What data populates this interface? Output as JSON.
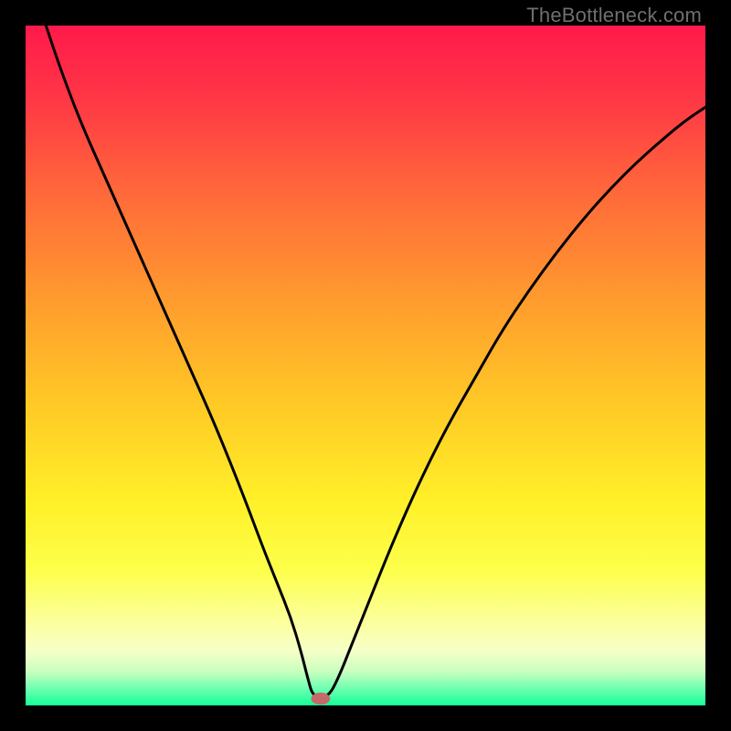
{
  "watermark": "TheBottleneck.com",
  "chart_data": {
    "type": "line",
    "title": "",
    "xlabel": "",
    "ylabel": "",
    "xlim": [
      0,
      100
    ],
    "ylim": [
      0,
      100
    ],
    "background_gradient": {
      "stops": [
        {
          "offset": 0.0,
          "color": "#ff1a4b"
        },
        {
          "offset": 0.1,
          "color": "#ff3446"
        },
        {
          "offset": 0.25,
          "color": "#ff6a3a"
        },
        {
          "offset": 0.4,
          "color": "#ff9a2e"
        },
        {
          "offset": 0.55,
          "color": "#ffc726"
        },
        {
          "offset": 0.7,
          "color": "#fff028"
        },
        {
          "offset": 0.8,
          "color": "#fdff4a"
        },
        {
          "offset": 0.88,
          "color": "#fcffa0"
        },
        {
          "offset": 0.92,
          "color": "#f6ffc8"
        },
        {
          "offset": 0.95,
          "color": "#c9ffbf"
        },
        {
          "offset": 0.975,
          "color": "#6fffb0"
        },
        {
          "offset": 1.0,
          "color": "#15ff99"
        }
      ]
    },
    "series": [
      {
        "name": "bottleneck-curve",
        "color": "#000000",
        "x": [
          3,
          5,
          8,
          12,
          16,
          20,
          24,
          28,
          32,
          35,
          37,
          39,
          40.5,
          41.5,
          42.3,
          44.5,
          46,
          48,
          50,
          54,
          58,
          62,
          66,
          70,
          74,
          78,
          82,
          86,
          90,
          94,
          97,
          100
        ],
        "y": [
          100,
          94,
          86,
          77,
          68,
          59,
          50,
          41,
          31,
          23,
          18,
          13,
          8,
          4,
          1.2,
          1.2,
          4,
          9,
          14,
          24,
          33,
          41,
          48,
          55,
          61,
          66.5,
          71.5,
          76,
          80,
          83.5,
          86,
          88
        ]
      }
    ],
    "marker": {
      "name": "min-marker",
      "x": 43.4,
      "y": 1.0,
      "rx": 1.4,
      "ry": 0.9,
      "fill": "#c46a6a"
    }
  }
}
